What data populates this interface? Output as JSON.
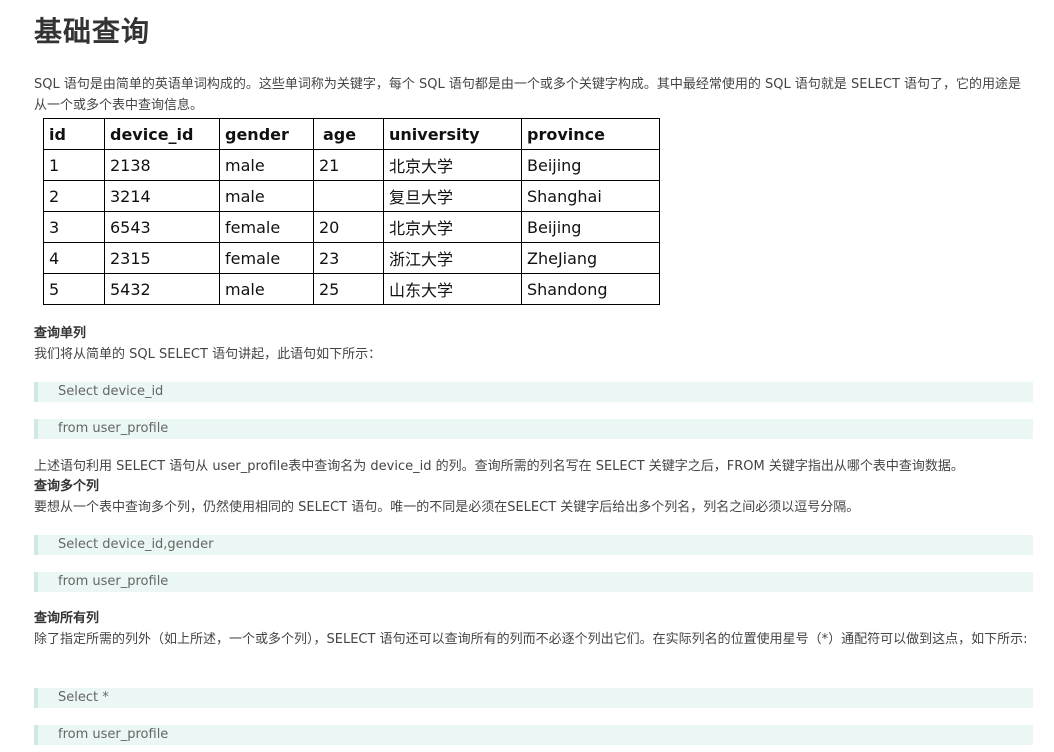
{
  "page": {
    "title": "基础查询",
    "intro": "SQL 语句是由简单的英语单词构成的。这些单词称为关键字，每个 SQL 语句都是由一个或多个关键字构成。其中最经常使用的 SQL 语句就是 SELECT 语句了，它的用途是从一个或多个表中查询信息。"
  },
  "table": {
    "headers": [
      "id",
      "device_id",
      "gender",
      "age",
      "university",
      "province"
    ],
    "rows": [
      [
        "1",
        "2138",
        "male",
        "21",
        "北京大学",
        "Beijing"
      ],
      [
        "2",
        "3214",
        "male",
        "",
        "复旦大学",
        "Shanghai"
      ],
      [
        "3",
        "6543",
        "female",
        "20",
        "北京大学",
        "Beijing"
      ],
      [
        "4",
        "2315",
        "female",
        "23",
        "浙江大学",
        "ZheJiang"
      ],
      [
        "5",
        "5432",
        "male",
        "25",
        "山东大学",
        "Shandong"
      ]
    ]
  },
  "section1": {
    "heading": "查询单列",
    "text": "我们将从简单的 SQL SELECT 语句讲起，此语句如下所示：",
    "code": [
      "Select device_id",
      "from user_profile"
    ],
    "after": "上述语句利用 SELECT 语句从 user_profile表中查询名为 device_id 的列。查询所需的列名写在 SELECT 关键字之后，FROM 关键字指出从哪个表中查询数据。"
  },
  "section2": {
    "heading": "查询多个列",
    "text": "要想从一个表中查询多个列，仍然使用相同的 SELECT 语句。唯一的不同是必须在SELECT 关键字后给出多个列名，列名之间必须以逗号分隔。",
    "code": [
      "Select device_id,gender",
      "from user_profile"
    ]
  },
  "section3": {
    "heading": "查询所有列",
    "text": "除了指定所需的列外（如上所述，一个或多个列），SELECT 语句还可以查询所有的列而不必逐个列出它们。在实际列名的位置使用星号（*）通配符可以做到这点，如下所示:",
    "code": [
      "Select *",
      "from user_profile"
    ]
  }
}
